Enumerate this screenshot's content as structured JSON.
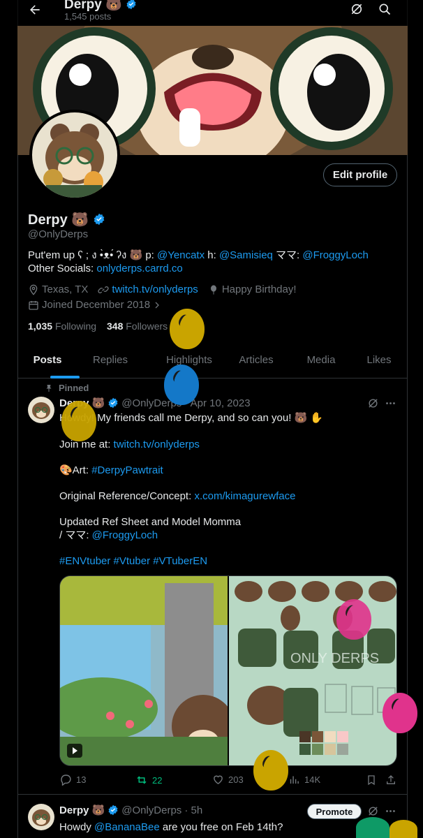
{
  "header": {
    "name": "Derpy",
    "emoji": "🐻",
    "post_count": "1,545 posts"
  },
  "profile": {
    "name": "Derpy",
    "emoji": "🐻",
    "handle": "@OnlyDerps",
    "edit_label": "Edit profile",
    "bio": {
      "prefix": "Put'em up ʕ ; ง •̀ᴥ•́ ʔง 🐻 p: ",
      "mention1": "@Yencatx",
      "mid1": " h: ",
      "mention2": "@Samisieq",
      "mid2": " ママ: ",
      "mention3": "@FroggyLoch",
      "mid3": " Other Socials: ",
      "link": "onlyderps.carrd.co"
    },
    "location": "Texas, TX",
    "website": "twitch.tv/onlyderps",
    "birthday": "Happy Birthday!",
    "joined": "Joined December 2018",
    "following_count": "1,035",
    "following_label": "Following",
    "followers_count": "348",
    "followers_label": "Followers"
  },
  "tabs": [
    "Posts",
    "Replies",
    "Highlights",
    "Articles",
    "Media",
    "Likes"
  ],
  "pinned_post": {
    "pinned_label": "Pinned",
    "name": "Derpy",
    "emoji": "🐻",
    "handle": "@OnlyDerps",
    "date": "· Apr 10, 2023",
    "line1": "Howdy! My friends call me Derpy, and so can you! 🐻 ✋",
    "line2_prefix": "Join me at: ",
    "line2_link": "twitch.tv/onlyderps",
    "line3_prefix": "🎨Art: ",
    "line3_link": "#DerpyPawtrait",
    "line4_prefix": "Original Reference/Concept: ",
    "line4_link": "x.com/kimagurewface",
    "line5": "Updated Ref Sheet and Model Momma",
    "line6_prefix": "/ ママ: ",
    "line6_link": "@FroggyLoch",
    "hashtags": "#ENVtuber #Vtuber #VTuberEN",
    "replies": "13",
    "reposts": "22",
    "likes": "203",
    "views": "14K",
    "watermark": "ONLY DERPS"
  },
  "second_post": {
    "name": "Derpy",
    "emoji": "🐻",
    "handle": "@OnlyDerps",
    "time": "· 5h",
    "promote_label": "Promote",
    "text_prefix": "Howdy ",
    "mention": "@BananaBee",
    "text_suffix": " are you free on Feb 14th?"
  },
  "colors": {
    "accent": "#1d9bf0",
    "repost_green": "#00ba7c",
    "balloon_yellow": "#c9a400",
    "balloon_blue": "#1478c8",
    "balloon_pink": "#e0338c",
    "balloon_green": "#0e9a66"
  }
}
